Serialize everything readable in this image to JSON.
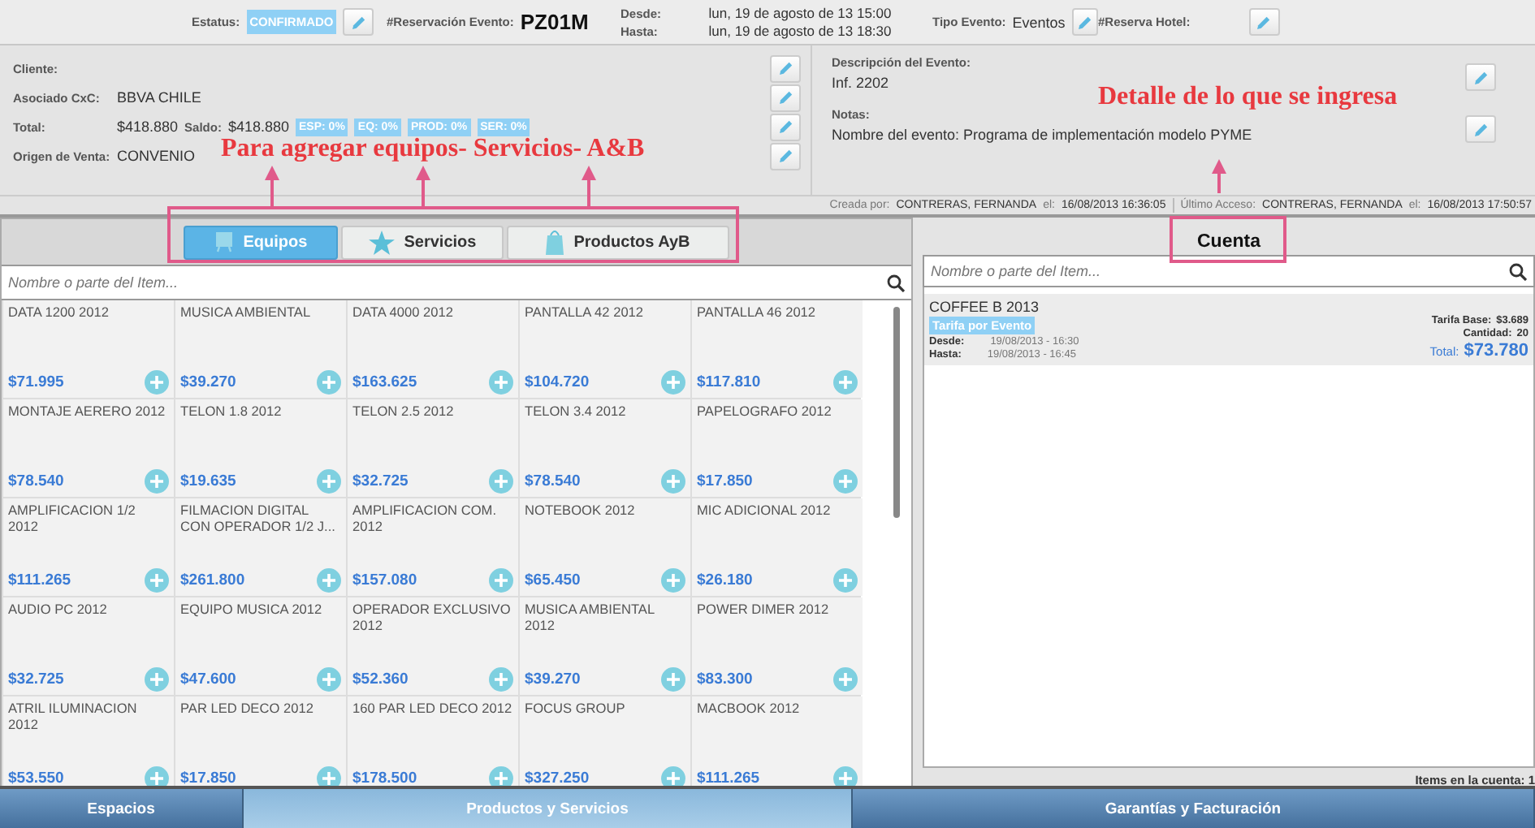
{
  "header": {
    "status_label": "Estatus:",
    "status": "CONFIRMADO",
    "reservation_label": "#Reservación Evento:",
    "reservation": "PZ01M",
    "desde_label": "Desde:",
    "desde": "lun, 19 de agosto de 13  15:00",
    "hasta_label": "Hasta:",
    "hasta": "lun, 19 de agosto de 13  18:30",
    "tipo_label": "Tipo Evento:",
    "tipo": "Eventos",
    "hotel_label": "#Reserva Hotel:"
  },
  "client": {
    "cliente_label": "Cliente:",
    "asociado_label": "Asociado CxC:",
    "asociado": "BBVA CHILE",
    "total_label": "Total:",
    "total": "$418.880",
    "saldo_label": "Saldo:",
    "saldo": "$418.880",
    "badges": [
      "ESP: 0%",
      "EQ: 0%",
      "PROD: 0%",
      "SER: 0%"
    ],
    "origen_label": "Origen de Venta:",
    "origen": "CONVENIO"
  },
  "description": {
    "label": "Descripción del Evento:",
    "value": "Inf. 2202"
  },
  "notes": {
    "label": "Notas:",
    "value": "Nombre del evento: Programa de implementación modelo PYME"
  },
  "audit": {
    "created_label": "Creada por:",
    "created_by": "CONTRERAS, FERNANDA",
    "created_el": "el:",
    "created_at": "16/08/2013 16:36:05",
    "access_label": "Último Acceso:",
    "access_by": "CONTRERAS, FERNANDA",
    "access_el": "el:",
    "access_at": "16/08/2013 17:50:57"
  },
  "tabs": [
    {
      "label": "Equipos",
      "selected": true
    },
    {
      "label": "Servicios",
      "selected": false
    },
    {
      "label": "Productos AyB",
      "selected": false
    }
  ],
  "catalog": {
    "placeholder": "Nombre o parte del Item...",
    "items": [
      {
        "name": "DATA 1200 2012",
        "price": "$71.995"
      },
      {
        "name": "MUSICA AMBIENTAL",
        "price": "$39.270"
      },
      {
        "name": "DATA 4000 2012",
        "price": "$163.625"
      },
      {
        "name": "PANTALLA 42 2012",
        "price": "$104.720"
      },
      {
        "name": "PANTALLA 46 2012",
        "price": "$117.810"
      },
      {
        "name": "MONTAJE AERERO 2012",
        "price": "$78.540"
      },
      {
        "name": "TELON 1.8 2012",
        "price": "$19.635"
      },
      {
        "name": "TELON 2.5 2012",
        "price": "$32.725"
      },
      {
        "name": "TELON 3.4 2012",
        "price": "$78.540"
      },
      {
        "name": "PAPELOGRAFO 2012",
        "price": "$17.850"
      },
      {
        "name": "AMPLIFICACION 1/2 2012",
        "price": "$111.265"
      },
      {
        "name": "FILMACION DIGITAL CON OPERADOR 1/2 J...",
        "price": "$261.800"
      },
      {
        "name": "AMPLIFICACION COM. 2012",
        "price": "$157.080"
      },
      {
        "name": "NOTEBOOK 2012",
        "price": "$65.450"
      },
      {
        "name": "MIC ADICIONAL 2012",
        "price": "$26.180"
      },
      {
        "name": "AUDIO PC 2012",
        "price": "$32.725"
      },
      {
        "name": "EQUIPO MUSICA 2012",
        "price": "$47.600"
      },
      {
        "name": "OPERADOR EXCLUSIVO 2012",
        "price": "$52.360"
      },
      {
        "name": "MUSICA AMBIENTAL 2012",
        "price": "$39.270"
      },
      {
        "name": "POWER DIMER 2012",
        "price": "$83.300"
      },
      {
        "name": "ATRIL ILUMINACION 2012",
        "price": "$53.550"
      },
      {
        "name": "PAR LED DECO 2012",
        "price": "$17.850"
      },
      {
        "name": "160 PAR LED DECO 2012",
        "price": "$178.500"
      },
      {
        "name": "FOCUS GROUP",
        "price": "$327.250"
      },
      {
        "name": "MACBOOK 2012",
        "price": "$111.265"
      }
    ]
  },
  "account": {
    "title": "Cuenta",
    "placeholder": "Nombre o parte del Item...",
    "items": [
      {
        "name": "COFFEE B 2013",
        "tag": "Tarifa por Evento",
        "desde_label": "Desde:",
        "desde": "19/08/2013 - 16:30",
        "hasta_label": "Hasta:",
        "hasta": "19/08/2013 - 16:45",
        "base_label": "Tarifa Base:",
        "base": "$3.689",
        "qty_label": "Cantidad:",
        "qty": "20",
        "total_label": "Total:",
        "total": "$73.780"
      }
    ],
    "footer": "Items en la cuenta: 1"
  },
  "bottom_nav": [
    {
      "label": "Espacios",
      "selected": false
    },
    {
      "label": "Productos y Servicios",
      "selected": true
    },
    {
      "label": "Garantías y Facturación",
      "selected": false
    }
  ],
  "annotations": [
    {
      "text": "Para agregar equipos- Servicios- A&B"
    },
    {
      "text": "Detalle de lo que se ingresa"
    }
  ]
}
